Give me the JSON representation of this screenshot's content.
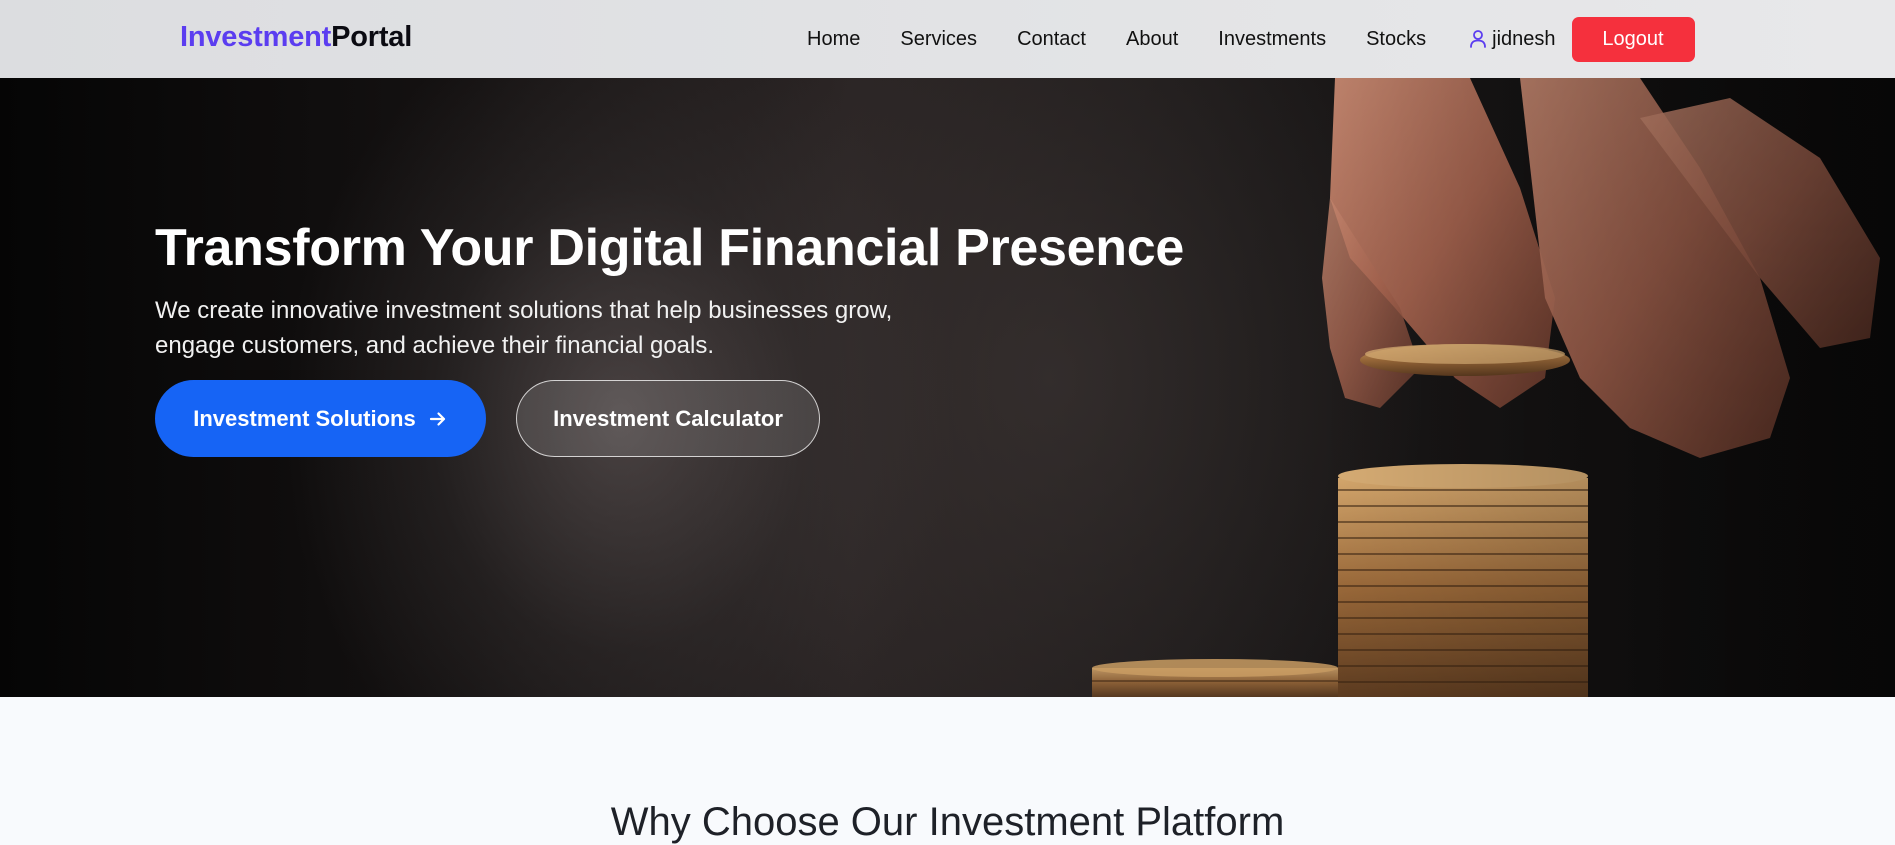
{
  "navbar": {
    "brand_part1": "Investment",
    "brand_part2": "Portal",
    "links": [
      "Home",
      "Services",
      "Contact",
      "About",
      "Investments",
      "Stocks"
    ],
    "username": "jidnesh",
    "logout_label": "Logout",
    "user_icon": "user-icon"
  },
  "hero": {
    "title": "Transform Your Digital Financial Presence",
    "subtitle": "We create innovative investment solutions that help businesses grow, engage customers, and achieve their financial goals.",
    "primary_button_label": "Investment Solutions",
    "primary_button_icon": "arrow-right-icon",
    "secondary_button_label": "Investment Calculator",
    "background_image": "hand-stacking-coins"
  },
  "why": {
    "title": "Why Choose Our Investment Platform"
  },
  "colors": {
    "brand_accent": "#5b3df0",
    "primary_button": "#1664f5",
    "logout_button": "#f5303d",
    "navbar_bg": "#e0e1e3"
  }
}
